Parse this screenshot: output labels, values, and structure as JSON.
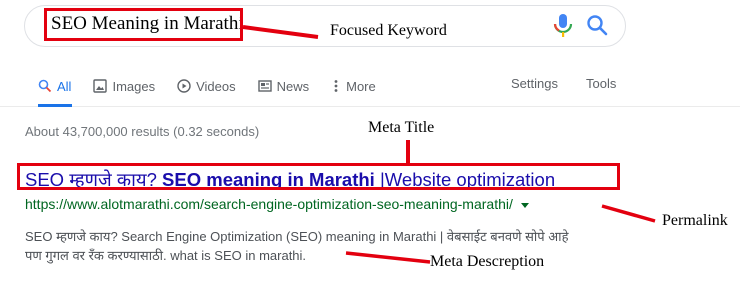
{
  "search": {
    "query": "SEO Meaning in Marathi"
  },
  "tabs": [
    {
      "label": "All",
      "icon": "search-icon"
    },
    {
      "label": "Images",
      "icon": "image-icon"
    },
    {
      "label": "Videos",
      "icon": "play-icon"
    },
    {
      "label": "News",
      "icon": "news-icon"
    },
    {
      "label": "More",
      "icon": "more-vert-icon"
    }
  ],
  "toolbar": {
    "settings": "Settings",
    "tools": "Tools"
  },
  "stats": "About 43,700,000 results (0.32 seconds)",
  "result": {
    "title_part1": "SEO म्हणजे काय? ",
    "title_part2": "SEO meaning in Marathi",
    "title_part3": " |Website optimization",
    "url": "https://www.alotmarathi.com/search-engine-optimization-seo-meaning-marathi/",
    "snippet_line1": "SEO म्हणजे काय? Search Engine Optimization (SEO) meaning in Marathi | वेबसाईट बनवणे सोपे आहे",
    "snippet_line2": "पण गुगल वर रँक करण्यासाठी. what is SEO in marathi."
  },
  "annotations": {
    "focused_keyword": "Focused Keyword",
    "meta_title": "Meta Title",
    "permalink": "Permalink",
    "meta_description": "Meta Descreption"
  },
  "colors": {
    "annotation_red": "#e3000f",
    "link_blue": "#1a0dab",
    "url_green": "#006621",
    "tab_active": "#1a73e8"
  }
}
